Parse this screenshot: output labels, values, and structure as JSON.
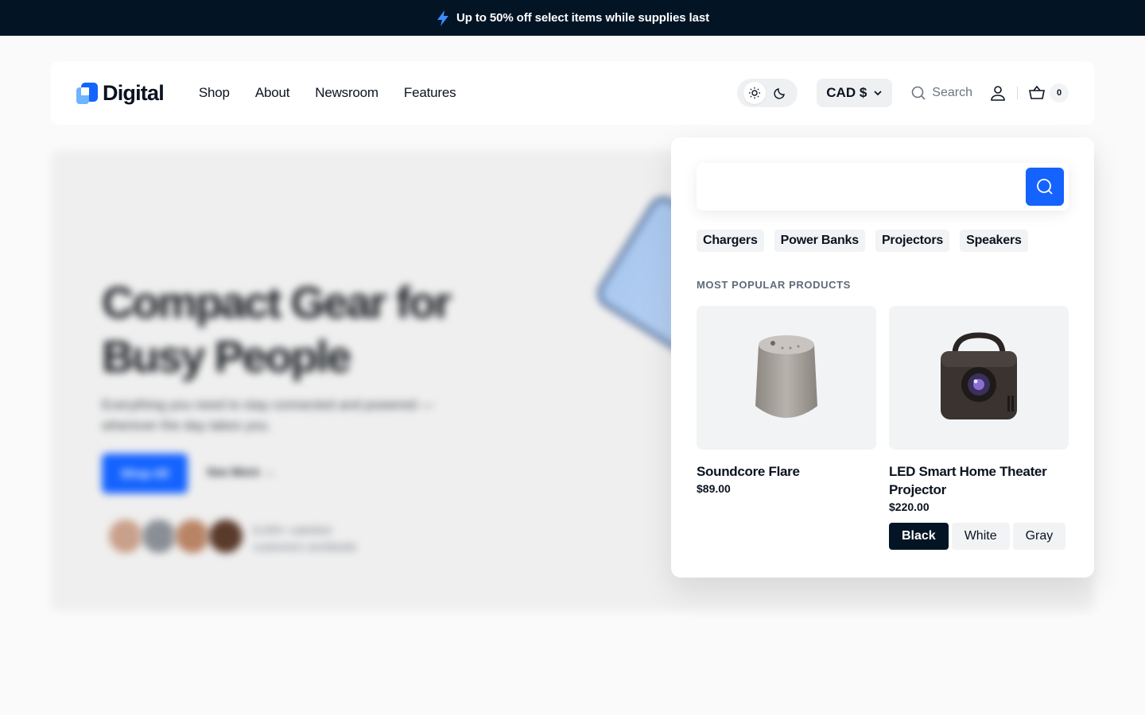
{
  "announcement": {
    "text": "Up to 50% off select items while supplies last",
    "icon": "lightning-icon"
  },
  "header": {
    "logo_text": "Digital",
    "nav": [
      "Shop",
      "About",
      "Newsroom",
      "Features"
    ],
    "currency": "CAD $",
    "search_label": "Search",
    "cart_count": "0"
  },
  "hero": {
    "title": "Compact Gear for Busy People",
    "subtitle": "Everything you need to stay connected and powered — wherever the day takes you.",
    "cta": "Shop All",
    "link": "See More →",
    "social_proof": "8,000+ satisfied customers worldwide"
  },
  "search_panel": {
    "query": "",
    "chips": [
      "Chargers",
      "Power Banks",
      "Projectors",
      "Speakers"
    ],
    "section_title": "MOST POPULAR PRODUCTS",
    "products": [
      {
        "name": "Soundcore Flare",
        "price": "$89.00"
      },
      {
        "name": "LED Smart Home Theater Projector",
        "price": "$220.00",
        "variants": [
          "Black",
          "White",
          "Gray"
        ],
        "selected_variant": "Black"
      }
    ]
  },
  "colors": {
    "announcement_bg": "#031525",
    "primary": "#1463ff",
    "selected_variant_bg": "#031525"
  }
}
